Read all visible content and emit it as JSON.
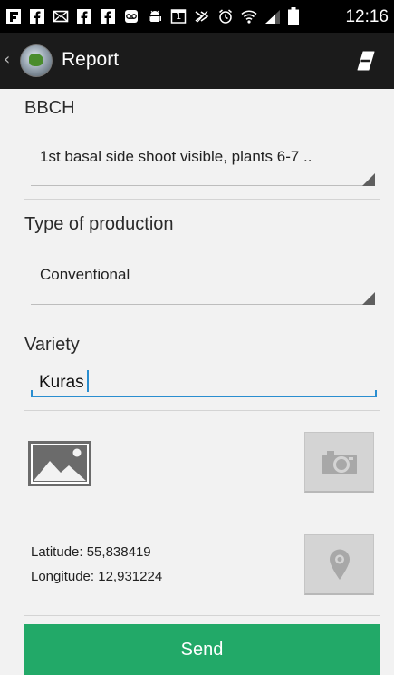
{
  "status_bar": {
    "time": "12:16",
    "icons": [
      "flipboard-icon",
      "facebook-icon",
      "mail-icon",
      "facebook-icon",
      "facebook-icon",
      "voicemail-icon",
      "android-debug-icon",
      "calendar-icon",
      "nfc-icon",
      "alarm-icon",
      "wifi-icon",
      "signal-icon",
      "battery-icon"
    ],
    "calendar_day": "1"
  },
  "action_bar": {
    "back_glyph": "‹",
    "title": "Report"
  },
  "form": {
    "bbch": {
      "label": "BBCH",
      "value": "1st basal side shoot visible, plants 6-7 .."
    },
    "production": {
      "label": "Type of production",
      "value": "Conventional"
    },
    "variety": {
      "label": "Variety",
      "value": "Kuras"
    },
    "location": {
      "latitude_label": "Latitude:",
      "latitude_value": "55,838419",
      "longitude_label": "Longitude:",
      "longitude_value": "12,931224"
    }
  },
  "send_button": {
    "label": "Send"
  },
  "colors": {
    "accent_blue": "#2a8ed0",
    "send_green": "#22a968",
    "action_bar": "#1b1b1b",
    "background": "#f2f2f2"
  }
}
